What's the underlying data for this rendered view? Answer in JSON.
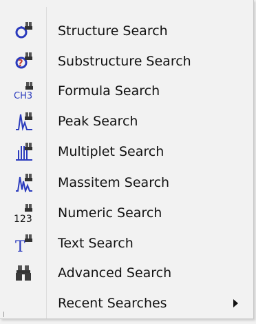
{
  "menu": {
    "items": [
      {
        "label": "Structure Search",
        "icon": "structure-search-icon"
      },
      {
        "label": "Substructure Search",
        "icon": "substructure-search-icon"
      },
      {
        "label": "Formula Search",
        "icon": "formula-search-icon",
        "icon_text": "CH3"
      },
      {
        "label": "Peak Search",
        "icon": "peak-search-icon"
      },
      {
        "label": "Multiplet Search",
        "icon": "multiplet-search-icon"
      },
      {
        "label": "Massitem Search",
        "icon": "massitem-search-icon"
      },
      {
        "label": "Numeric Search",
        "icon": "numeric-search-icon",
        "icon_text": "123"
      },
      {
        "label": "Text Search",
        "icon": "text-search-icon",
        "icon_text": "T"
      },
      {
        "label": "Advanced Search",
        "icon": "binoculars-icon"
      },
      {
        "label": "Recent Searches",
        "icon": "submenu-arrow-icon",
        "has_submenu": true
      }
    ]
  },
  "colors": {
    "menu_background": "#f2f2f2",
    "icon_blue": "#2b3bbd",
    "icon_dark": "#333333",
    "text": "#111111"
  }
}
